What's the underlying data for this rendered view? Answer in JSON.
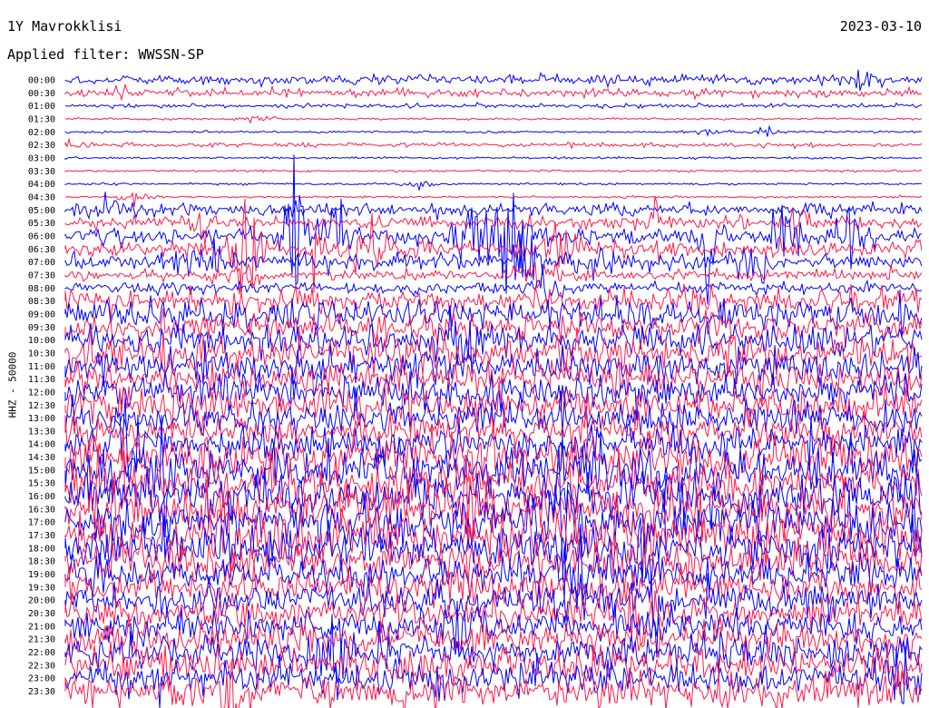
{
  "header": {
    "station": "1Y Mavrokklisi",
    "date": "2023-03-10",
    "filter_prefix": "Applied filter:",
    "filter_name": "WWSSN-SP"
  },
  "colors": {
    "even_rows": "#0000ff",
    "odd_rows": "#ff1a4a"
  },
  "chart_data": {
    "type": "line",
    "title": "1Y Mavrokklisi",
    "subtitle": "Applied filter: WWSSN-SP",
    "ylabel": "HHZ - 50000",
    "xlabel": "",
    "channel": "HHZ",
    "scale": 50000,
    "row_interval_minutes": 30,
    "row_labels": [
      "00:00",
      "00:30",
      "01:00",
      "01:30",
      "02:00",
      "02:30",
      "03:00",
      "03:30",
      "04:00",
      "04:30",
      "05:00",
      "05:30",
      "06:00",
      "06:30",
      "07:00",
      "07:30",
      "08:00",
      "08:30",
      "09:00",
      "09:30",
      "10:00",
      "10:30",
      "11:00",
      "11:30",
      "12:00",
      "12:30",
      "13:00",
      "13:30",
      "14:00",
      "14:30",
      "15:00",
      "15:30",
      "16:00",
      "16:30",
      "17:00",
      "17:30",
      "18:00",
      "18:30",
      "19:00",
      "19:30",
      "20:00",
      "20:30",
      "21:00",
      "21:30",
      "22:00",
      "22:30",
      "23:00",
      "23:30"
    ],
    "row_noise_amplitude": [
      5,
      4,
      2,
      1,
      1,
      2,
      1,
      1,
      1,
      1,
      6,
      6,
      8,
      8,
      8,
      5,
      5,
      12,
      14,
      14,
      16,
      16,
      16,
      16,
      16,
      16,
      16,
      16,
      16,
      22,
      22,
      22,
      22,
      22,
      22,
      22,
      20,
      20,
      16,
      16,
      16,
      16,
      16,
      16,
      16,
      16,
      16,
      16
    ],
    "events": [
      {
        "row": 0,
        "position": 0.93,
        "amplitude": 12
      },
      {
        "row": 1,
        "position": 0.07,
        "amplitude": 8
      },
      {
        "row": 3,
        "position": 0.22,
        "amplitude": 6
      },
      {
        "row": 4,
        "position": 0.75,
        "amplitude": 6
      },
      {
        "row": 4,
        "position": 0.82,
        "amplitude": 5
      },
      {
        "row": 5,
        "position": 0.0,
        "amplitude": 4
      },
      {
        "row": 8,
        "position": 0.41,
        "amplitude": 5
      },
      {
        "row": 9,
        "position": 0.08,
        "amplitude": 8
      },
      {
        "row": 10,
        "position": 0.05,
        "amplitude": 20
      },
      {
        "row": 10,
        "position": 0.89,
        "amplitude": 12
      },
      {
        "row": 11,
        "position": 0.16,
        "amplitude": 22
      },
      {
        "row": 11,
        "position": 0.69,
        "amplitude": 28
      },
      {
        "row": 11,
        "position": 0.86,
        "amplitude": 24
      },
      {
        "row": 12,
        "position": 0.27,
        "amplitude": 70
      },
      {
        "row": 12,
        "position": 0.31,
        "amplitude": 45
      },
      {
        "row": 12,
        "position": 0.47,
        "amplitude": 90
      },
      {
        "row": 12,
        "position": 0.52,
        "amplitude": 120
      },
      {
        "row": 12,
        "position": 0.75,
        "amplitude": 60
      },
      {
        "row": 12,
        "position": 0.84,
        "amplitude": 70
      },
      {
        "row": 12,
        "position": 0.92,
        "amplitude": 40
      },
      {
        "row": 13,
        "position": 0.21,
        "amplitude": 90
      },
      {
        "row": 13,
        "position": 0.29,
        "amplitude": 30
      },
      {
        "row": 13,
        "position": 0.35,
        "amplitude": 55
      },
      {
        "row": 13,
        "position": 0.58,
        "amplitude": 30
      },
      {
        "row": 14,
        "position": 0.14,
        "amplitude": 30
      },
      {
        "row": 14,
        "position": 0.18,
        "amplitude": 22
      },
      {
        "row": 14,
        "position": 0.54,
        "amplitude": 60
      },
      {
        "row": 14,
        "position": 0.62,
        "amplitude": 20
      },
      {
        "row": 14,
        "position": 0.8,
        "amplitude": 30
      },
      {
        "row": 15,
        "position": 0.21,
        "amplitude": 25
      },
      {
        "row": 15,
        "position": 0.55,
        "amplitude": 30
      },
      {
        "row": 16,
        "position": 0.56,
        "amplitude": 30
      },
      {
        "row": 20,
        "position": 0.46,
        "amplitude": 40
      },
      {
        "row": 28,
        "position": 0.07,
        "amplitude": 70
      },
      {
        "row": 30,
        "position": 0.12,
        "amplitude": 60
      },
      {
        "row": 33,
        "position": 0.47,
        "amplitude": 60
      },
      {
        "row": 34,
        "position": 0.58,
        "amplitude": 70
      },
      {
        "row": 35,
        "position": 0.19,
        "amplitude": 50
      },
      {
        "row": 36,
        "position": 0.67,
        "amplitude": 60
      },
      {
        "row": 38,
        "position": 0.6,
        "amplitude": 40
      },
      {
        "row": 39,
        "position": 0.46,
        "amplitude": 50
      },
      {
        "row": 40,
        "position": 0.69,
        "amplitude": 45
      },
      {
        "row": 41,
        "position": 0.67,
        "amplitude": 40
      },
      {
        "row": 42,
        "position": 0.46,
        "amplitude": 50
      },
      {
        "row": 44,
        "position": 0.31,
        "amplitude": 35
      },
      {
        "row": 46,
        "position": 0.98,
        "amplitude": 40
      },
      {
        "row": 47,
        "position": 0.2,
        "amplitude": 40
      }
    ]
  }
}
